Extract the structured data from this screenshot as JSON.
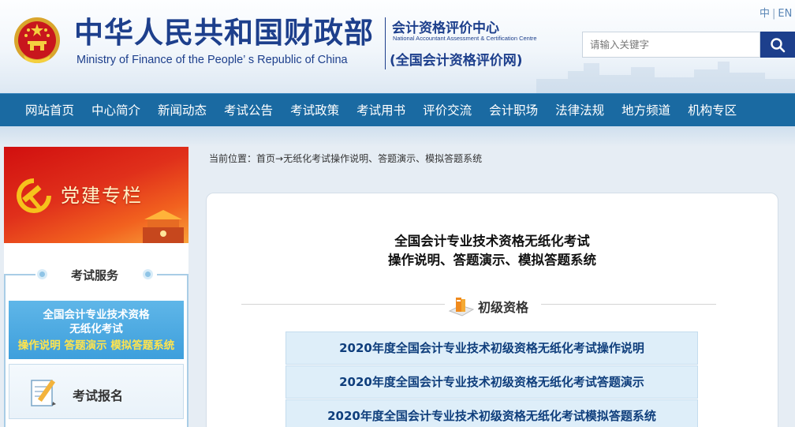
{
  "header": {
    "cn_title": "中华人民共和国财政部",
    "en_title": "Ministry of Finance of the People’ s Republic of China",
    "center_cn": "会计资格评价中心",
    "center_en": "National Accountant Assessment & Certification Centre",
    "center_paren": "(全国会计资格评价网)",
    "lang_cn": "中",
    "lang_en": "EN",
    "search_placeholder": "请输入关键字"
  },
  "nav": {
    "items": [
      "网站首页",
      "中心简介",
      "新闻动态",
      "考试公告",
      "考试政策",
      "考试用书",
      "评价交流",
      "会计职场",
      "法律法规",
      "地方频道",
      "机构专区"
    ]
  },
  "sidebar": {
    "party_banner": "党建专栏",
    "service_title": "考试服务",
    "blue_card": {
      "line1": "全国会计专业技术资格",
      "line2": "无纸化考试",
      "line3": "操作说明 答题演示 模拟答题系统"
    },
    "registration": "考试报名"
  },
  "breadcrumb": {
    "prefix": "当前位置：",
    "home": "首页",
    "rest": "→无纸化考试操作说明、答题演示、模拟答题系统"
  },
  "main": {
    "title_line1": "全国会计专业技术资格无纸化考试",
    "title_line2": "操作说明、答题演示、模拟答题系统",
    "section_label": "初级资格",
    "links": [
      "2020年度全国会计专业技术初级资格无纸化考试操作说明",
      "2020年度全国会计专业技术初级资格无纸化考试答题演示",
      "2020年度全国会计专业技术初级资格无纸化考试模拟答题系统"
    ]
  },
  "colors": {
    "brand_blue": "#1d3f8c",
    "nav_blue": "#1a6aa2",
    "link_bg": "#deeef9",
    "party_red": "#d10f0f"
  }
}
